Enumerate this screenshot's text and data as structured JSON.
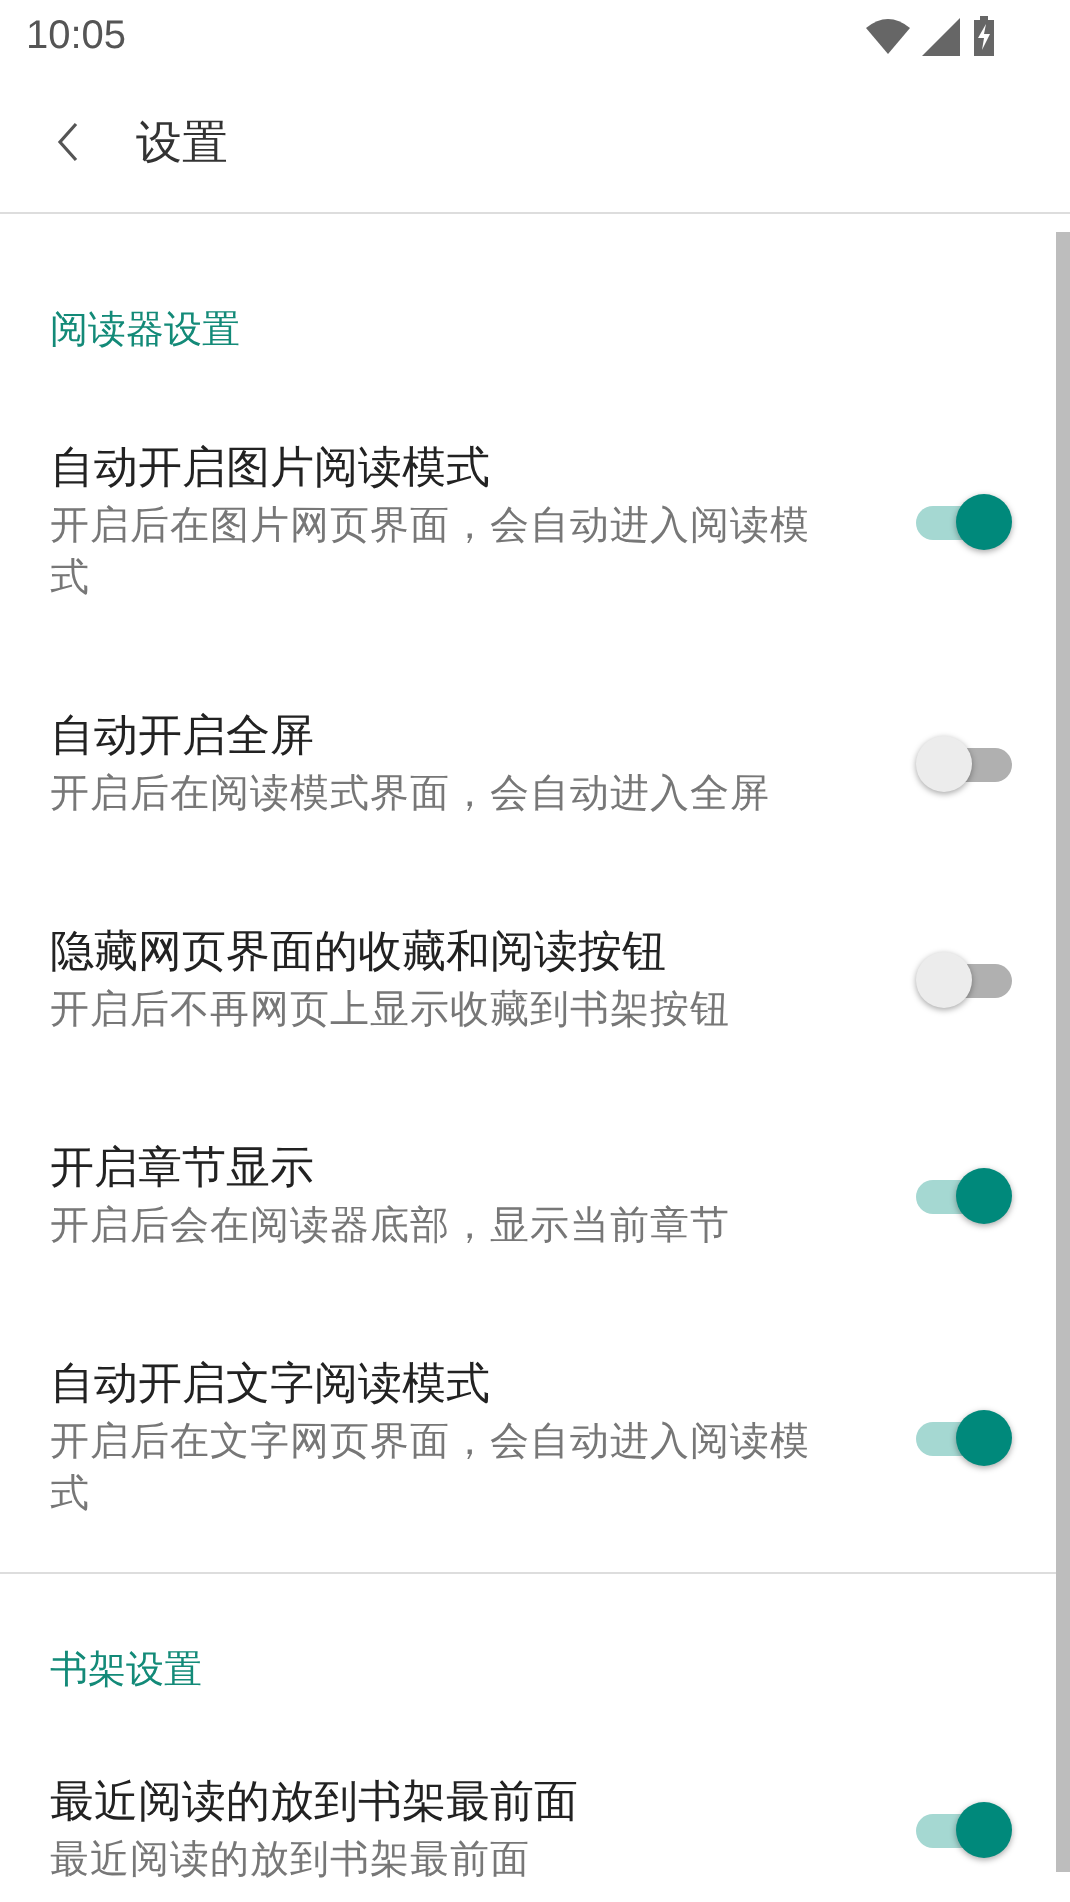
{
  "status_bar": {
    "time": "10:05"
  },
  "app_bar": {
    "title": "设置"
  },
  "sections": [
    {
      "title": "阅读器设置",
      "items": [
        {
          "title": "自动开启图片阅读模式",
          "subtitle": "开启后在图片网页界面，会自动进入阅读模式",
          "on": true
        },
        {
          "title": "自动开启全屏",
          "subtitle": "开启后在阅读模式界面，会自动进入全屏",
          "on": false
        },
        {
          "title": "隐藏网页界面的收藏和阅读按钮",
          "subtitle": "开启后不再网页上显示收藏到书架按钮",
          "on": false
        },
        {
          "title": "开启章节显示",
          "subtitle": "开启后会在阅读器底部，显示当前章节",
          "on": true
        },
        {
          "title": "自动开启文字阅读模式",
          "subtitle": "开启后在文字网页界面，会自动进入阅读模式",
          "on": true
        }
      ]
    },
    {
      "title": "书架设置",
      "items": [
        {
          "title": "最近阅读的放到书架最前面",
          "subtitle": "最近阅读的放到书架最前面",
          "on": true
        }
      ]
    }
  ]
}
